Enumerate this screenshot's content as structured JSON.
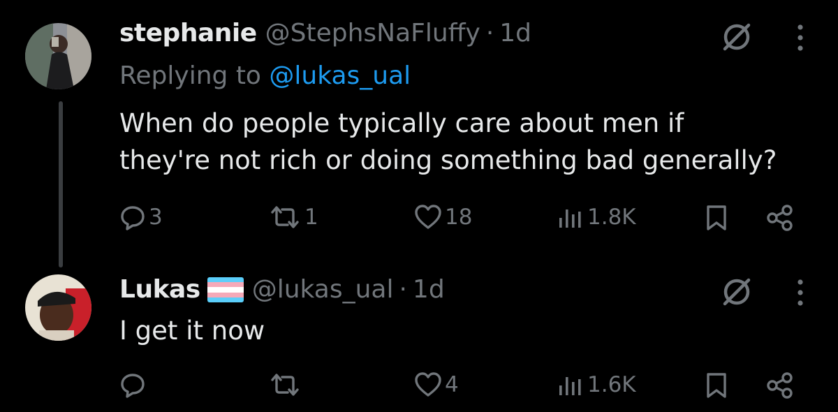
{
  "tweets": [
    {
      "name": "stephanie",
      "handle": "@StephsNaFluffy",
      "separator": "·",
      "time": "1d",
      "replying_prefix": "Replying to",
      "replying_to": "@lukas_ual",
      "text_line1": "When do people typically care about men if",
      "text_line2": "they're not rich or doing something bad generally?",
      "replies": "3",
      "reposts": "1",
      "likes": "18",
      "views": "1.8K"
    },
    {
      "name": "Lukas",
      "flag_icon": "transgender-flag-emoji",
      "flag_colors": [
        "#5bcefa",
        "#f5a9b8",
        "#ffffff",
        "#f5a9b8",
        "#5bcefa"
      ],
      "handle": "@lukas_ual",
      "separator": "·",
      "time": "1d",
      "text_line1": "I get it now",
      "likes": "4",
      "views": "1.6K"
    }
  ],
  "colors": {
    "background": "#000000",
    "primary_text": "#e7e9ea",
    "secondary_text": "#71767b",
    "accent": "#1d9bf0",
    "thread_line": "#3a3d40"
  }
}
